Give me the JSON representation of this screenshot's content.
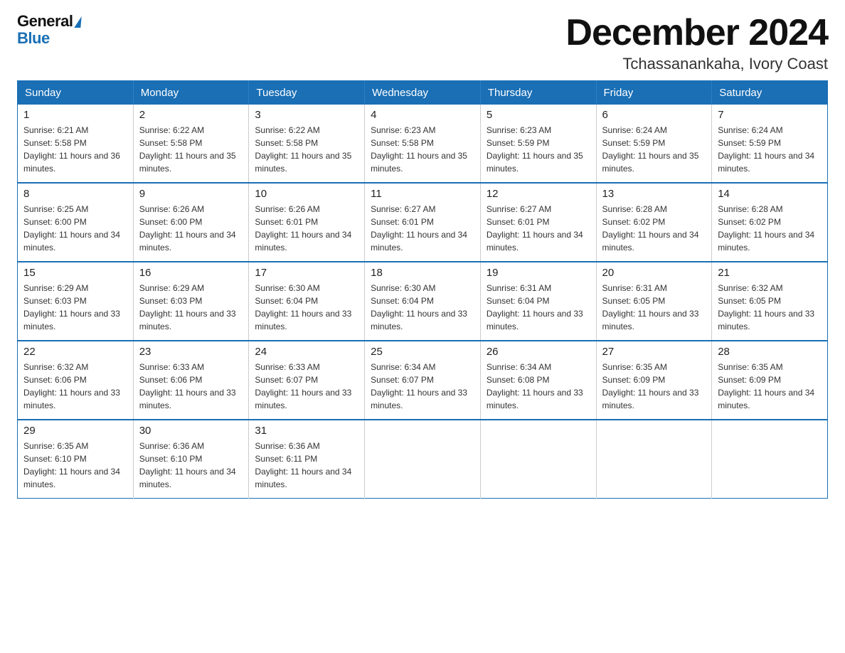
{
  "logo": {
    "general": "General",
    "blue": "Blue"
  },
  "title": {
    "month_year": "December 2024",
    "location": "Tchassanankaha, Ivory Coast"
  },
  "days_of_week": [
    "Sunday",
    "Monday",
    "Tuesday",
    "Wednesday",
    "Thursday",
    "Friday",
    "Saturday"
  ],
  "weeks": [
    [
      {
        "day": "1",
        "sunrise": "6:21 AM",
        "sunset": "5:58 PM",
        "daylight": "11 hours and 36 minutes."
      },
      {
        "day": "2",
        "sunrise": "6:22 AM",
        "sunset": "5:58 PM",
        "daylight": "11 hours and 35 minutes."
      },
      {
        "day": "3",
        "sunrise": "6:22 AM",
        "sunset": "5:58 PM",
        "daylight": "11 hours and 35 minutes."
      },
      {
        "day": "4",
        "sunrise": "6:23 AM",
        "sunset": "5:58 PM",
        "daylight": "11 hours and 35 minutes."
      },
      {
        "day": "5",
        "sunrise": "6:23 AM",
        "sunset": "5:59 PM",
        "daylight": "11 hours and 35 minutes."
      },
      {
        "day": "6",
        "sunrise": "6:24 AM",
        "sunset": "5:59 PM",
        "daylight": "11 hours and 35 minutes."
      },
      {
        "day": "7",
        "sunrise": "6:24 AM",
        "sunset": "5:59 PM",
        "daylight": "11 hours and 34 minutes."
      }
    ],
    [
      {
        "day": "8",
        "sunrise": "6:25 AM",
        "sunset": "6:00 PM",
        "daylight": "11 hours and 34 minutes."
      },
      {
        "day": "9",
        "sunrise": "6:26 AM",
        "sunset": "6:00 PM",
        "daylight": "11 hours and 34 minutes."
      },
      {
        "day": "10",
        "sunrise": "6:26 AM",
        "sunset": "6:01 PM",
        "daylight": "11 hours and 34 minutes."
      },
      {
        "day": "11",
        "sunrise": "6:27 AM",
        "sunset": "6:01 PM",
        "daylight": "11 hours and 34 minutes."
      },
      {
        "day": "12",
        "sunrise": "6:27 AM",
        "sunset": "6:01 PM",
        "daylight": "11 hours and 34 minutes."
      },
      {
        "day": "13",
        "sunrise": "6:28 AM",
        "sunset": "6:02 PM",
        "daylight": "11 hours and 34 minutes."
      },
      {
        "day": "14",
        "sunrise": "6:28 AM",
        "sunset": "6:02 PM",
        "daylight": "11 hours and 34 minutes."
      }
    ],
    [
      {
        "day": "15",
        "sunrise": "6:29 AM",
        "sunset": "6:03 PM",
        "daylight": "11 hours and 33 minutes."
      },
      {
        "day": "16",
        "sunrise": "6:29 AM",
        "sunset": "6:03 PM",
        "daylight": "11 hours and 33 minutes."
      },
      {
        "day": "17",
        "sunrise": "6:30 AM",
        "sunset": "6:04 PM",
        "daylight": "11 hours and 33 minutes."
      },
      {
        "day": "18",
        "sunrise": "6:30 AM",
        "sunset": "6:04 PM",
        "daylight": "11 hours and 33 minutes."
      },
      {
        "day": "19",
        "sunrise": "6:31 AM",
        "sunset": "6:04 PM",
        "daylight": "11 hours and 33 minutes."
      },
      {
        "day": "20",
        "sunrise": "6:31 AM",
        "sunset": "6:05 PM",
        "daylight": "11 hours and 33 minutes."
      },
      {
        "day": "21",
        "sunrise": "6:32 AM",
        "sunset": "6:05 PM",
        "daylight": "11 hours and 33 minutes."
      }
    ],
    [
      {
        "day": "22",
        "sunrise": "6:32 AM",
        "sunset": "6:06 PM",
        "daylight": "11 hours and 33 minutes."
      },
      {
        "day": "23",
        "sunrise": "6:33 AM",
        "sunset": "6:06 PM",
        "daylight": "11 hours and 33 minutes."
      },
      {
        "day": "24",
        "sunrise": "6:33 AM",
        "sunset": "6:07 PM",
        "daylight": "11 hours and 33 minutes."
      },
      {
        "day": "25",
        "sunrise": "6:34 AM",
        "sunset": "6:07 PM",
        "daylight": "11 hours and 33 minutes."
      },
      {
        "day": "26",
        "sunrise": "6:34 AM",
        "sunset": "6:08 PM",
        "daylight": "11 hours and 33 minutes."
      },
      {
        "day": "27",
        "sunrise": "6:35 AM",
        "sunset": "6:09 PM",
        "daylight": "11 hours and 33 minutes."
      },
      {
        "day": "28",
        "sunrise": "6:35 AM",
        "sunset": "6:09 PM",
        "daylight": "11 hours and 34 minutes."
      }
    ],
    [
      {
        "day": "29",
        "sunrise": "6:35 AM",
        "sunset": "6:10 PM",
        "daylight": "11 hours and 34 minutes."
      },
      {
        "day": "30",
        "sunrise": "6:36 AM",
        "sunset": "6:10 PM",
        "daylight": "11 hours and 34 minutes."
      },
      {
        "day": "31",
        "sunrise": "6:36 AM",
        "sunset": "6:11 PM",
        "daylight": "11 hours and 34 minutes."
      },
      null,
      null,
      null,
      null
    ]
  ]
}
